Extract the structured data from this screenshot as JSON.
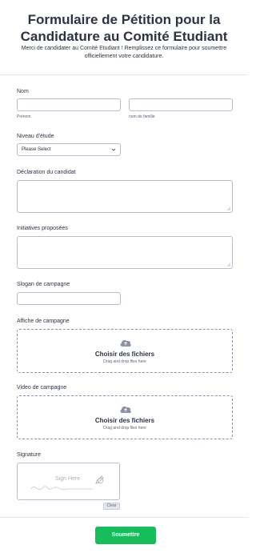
{
  "header": {
    "title": "Formulaire de Pétition pour la Candidature au Comité Etudiant",
    "subtitle": "Merci de candidater au Comité Etudiant ! Remplissez ce formulaire pour soumettre officiellement votre candidature."
  },
  "fields": {
    "name": {
      "label": "Nom",
      "first_sublabel": "Prénom",
      "last_sublabel": "nom de famille",
      "first_value": "",
      "last_value": ""
    },
    "level": {
      "label": "Niveau d'étude",
      "selected": "Please Select"
    },
    "statement": {
      "label": "Déclaration du candidat",
      "value": ""
    },
    "initiatives": {
      "label": "Initiatives proposées",
      "value": ""
    },
    "slogan": {
      "label": "Slogan de campagne",
      "value": ""
    },
    "poster": {
      "label": "Affiche de campagne",
      "upload_title": "Choisir des fichiers",
      "upload_hint": "Drag and drop files here"
    },
    "video": {
      "label": "Video de campagne",
      "upload_title": "Choisir des fichiers",
      "upload_hint": "Drag and drop files here"
    },
    "signature": {
      "label": "Signature",
      "hint": "Sign Here",
      "clear_label": "Clear"
    }
  },
  "submit_label": "Soumettre",
  "colors": {
    "accent": "#18bd5b",
    "text": "#2c3345",
    "border": "#b8bdc9",
    "muted": "#57647e"
  },
  "icons": {
    "upload": "cloud-upload-icon",
    "select": "chevron-down-icon",
    "signature": "pen-icon",
    "resize": "resize-grip-icon"
  }
}
